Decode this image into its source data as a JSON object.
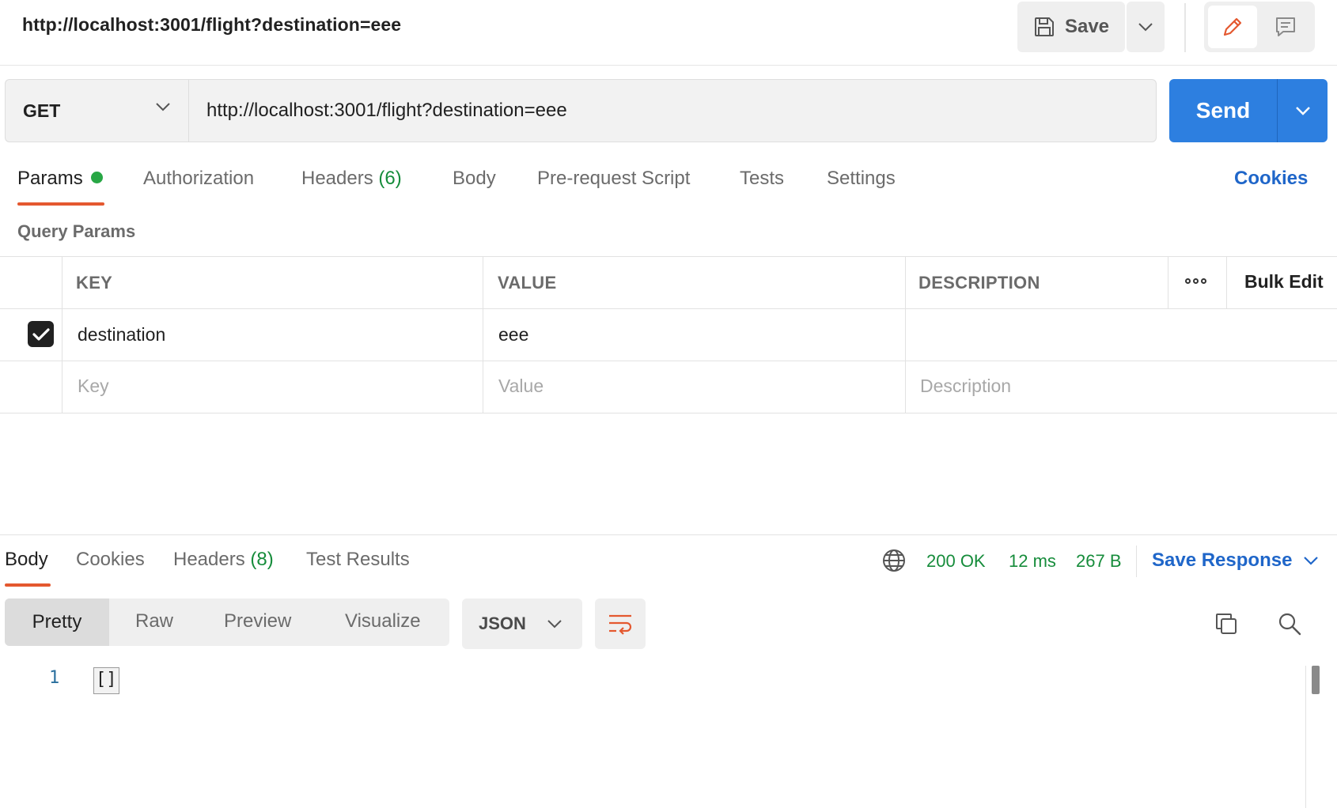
{
  "header": {
    "title": "http://localhost:3001/flight?destination=eee",
    "save_label": "Save"
  },
  "request": {
    "method": "GET",
    "url": "http://localhost:3001/flight?destination=eee",
    "send_label": "Send"
  },
  "request_tabs": {
    "params": "Params",
    "authorization": "Authorization",
    "headers": "Headers",
    "headers_count": "(6)",
    "body": "Body",
    "pre_request_script": "Pre-request Script",
    "tests": "Tests",
    "settings": "Settings",
    "cookies": "Cookies"
  },
  "query_params": {
    "section_label": "Query Params",
    "columns": {
      "key": "KEY",
      "value": "VALUE",
      "description": "DESCRIPTION",
      "bulk_edit": "Bulk Edit"
    },
    "rows": [
      {
        "checked": true,
        "key": "destination",
        "value": "eee",
        "description": ""
      }
    ],
    "placeholders": {
      "key": "Key",
      "value": "Value",
      "description": "Description"
    }
  },
  "response_tabs": {
    "body": "Body",
    "cookies": "Cookies",
    "headers": "Headers",
    "headers_count": "(8)",
    "test_results": "Test Results"
  },
  "response_status": {
    "status": "200 OK",
    "time": "12 ms",
    "size": "267 B",
    "save_response": "Save Response"
  },
  "response_view": {
    "modes": [
      "Pretty",
      "Raw",
      "Preview",
      "Visualize"
    ],
    "active_mode": "Pretty",
    "format": "JSON"
  },
  "response_body": {
    "lines": [
      {
        "number": "1",
        "content": "[]"
      }
    ]
  },
  "colors": {
    "accent_orange": "#e4582f",
    "send_blue": "#2d7fe0",
    "link_blue": "#1f66c9",
    "status_green": "#168c3b",
    "dot_green": "#28a745"
  }
}
